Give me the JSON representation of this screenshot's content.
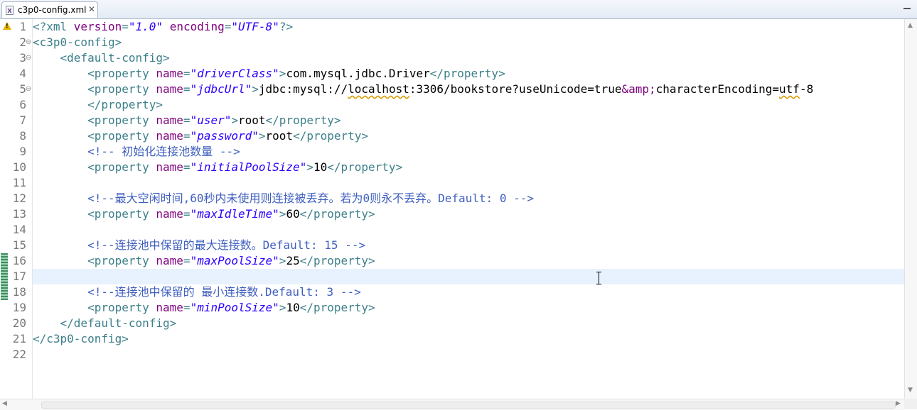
{
  "tab": {
    "title": "c3p0-config.xml",
    "close_glyph": "✕",
    "icon": "xml-file-icon",
    "icon_letter": "X"
  },
  "gutter": {
    "warning_icon": "warning-icon",
    "line_numbers": [
      "1",
      "2",
      "3",
      "4",
      "5",
      "6",
      "7",
      "8",
      "9",
      "10",
      "11",
      "12",
      "13",
      "14",
      "15",
      "16",
      "17",
      "18",
      "19",
      "20",
      "21",
      "22"
    ]
  },
  "editor": {
    "current_line": 17,
    "lines": [
      [
        [
          "pi",
          "<?xml "
        ],
        [
          "a",
          "version"
        ],
        [
          "pi",
          "="
        ],
        [
          "v",
          "\"1.0\""
        ],
        [
          "pi",
          " "
        ],
        [
          "a",
          "encoding"
        ],
        [
          "pi",
          "="
        ],
        [
          "v",
          "\"UTF-8\""
        ],
        [
          "pi",
          "?>"
        ]
      ],
      [
        [
          "t",
          "<c3p0-config>"
        ]
      ],
      [
        [
          "x",
          "    "
        ],
        [
          "t",
          "<default-config>"
        ]
      ],
      [
        [
          "x",
          "        "
        ],
        [
          "t",
          "<property "
        ],
        [
          "a",
          "name"
        ],
        [
          "t",
          "="
        ],
        [
          "v",
          "\"driverClass\""
        ],
        [
          "t",
          ">"
        ],
        [
          "x",
          "com.mysql.jdbc.Driver"
        ],
        [
          "t",
          "</property>"
        ]
      ],
      [
        [
          "x",
          "        "
        ],
        [
          "t",
          "<property "
        ],
        [
          "a",
          "name"
        ],
        [
          "t",
          "="
        ],
        [
          "v",
          "\"jdbcUrl\""
        ],
        [
          "t",
          ">"
        ],
        [
          "x",
          "jdbc:mysql://"
        ],
        [
          "sq",
          "localhost"
        ],
        [
          "x",
          ":3306/bookstore?useUnicode=true"
        ],
        [
          "a",
          "&amp;"
        ],
        [
          "x",
          "characterEncoding="
        ],
        [
          "sq",
          "utf"
        ],
        [
          "x",
          "-8"
        ]
      ],
      [
        [
          "x",
          "        "
        ],
        [
          "t",
          "</property>"
        ]
      ],
      [
        [
          "x",
          "        "
        ],
        [
          "t",
          "<property "
        ],
        [
          "a",
          "name"
        ],
        [
          "t",
          "="
        ],
        [
          "v",
          "\"user\""
        ],
        [
          "t",
          ">"
        ],
        [
          "x",
          "root"
        ],
        [
          "t",
          "</property>"
        ]
      ],
      [
        [
          "x",
          "        "
        ],
        [
          "t",
          "<property "
        ],
        [
          "a",
          "name"
        ],
        [
          "t",
          "="
        ],
        [
          "v",
          "\"password\""
        ],
        [
          "t",
          ">"
        ],
        [
          "x",
          "root"
        ],
        [
          "t",
          "</property>"
        ]
      ],
      [
        [
          "x",
          "        "
        ],
        [
          "c",
          "<!-- 初始化连接池数量 -->"
        ]
      ],
      [
        [
          "x",
          "        "
        ],
        [
          "t",
          "<property "
        ],
        [
          "a",
          "name"
        ],
        [
          "t",
          "="
        ],
        [
          "v",
          "\"initialPoolSize\""
        ],
        [
          "t",
          ">"
        ],
        [
          "x",
          "10"
        ],
        [
          "t",
          "</property>"
        ]
      ],
      [],
      [
        [
          "x",
          "        "
        ],
        [
          "c",
          "<!--最大空闲时间,60秒内未使用则连接被丢弃。若为0则永不丢弃。Default: 0 -->"
        ]
      ],
      [
        [
          "x",
          "        "
        ],
        [
          "t",
          "<property "
        ],
        [
          "a",
          "name"
        ],
        [
          "t",
          "="
        ],
        [
          "v",
          "\"maxIdleTime\""
        ],
        [
          "t",
          ">"
        ],
        [
          "x",
          "60"
        ],
        [
          "t",
          "</property>"
        ]
      ],
      [],
      [
        [
          "x",
          "        "
        ],
        [
          "c",
          "<!--连接池中保留的最大连接数。Default: 15 -->"
        ]
      ],
      [
        [
          "x",
          "        "
        ],
        [
          "t",
          "<property "
        ],
        [
          "a",
          "name"
        ],
        [
          "t",
          "="
        ],
        [
          "v",
          "\"maxPoolSize\""
        ],
        [
          "t",
          ">"
        ],
        [
          "x",
          "25"
        ],
        [
          "t",
          "</property>"
        ]
      ],
      [],
      [
        [
          "x",
          "        "
        ],
        [
          "c",
          "<!--连接池中保留的 最小连接数.Default: 3 -->"
        ]
      ],
      [
        [
          "x",
          "        "
        ],
        [
          "t",
          "<property "
        ],
        [
          "a",
          "name"
        ],
        [
          "t",
          "="
        ],
        [
          "v",
          "\"minPoolSize\""
        ],
        [
          "t",
          ">"
        ],
        [
          "x",
          "10"
        ],
        [
          "t",
          "</property>"
        ]
      ],
      [
        [
          "x",
          "    "
        ],
        [
          "t",
          "</default-config>"
        ]
      ],
      [
        [
          "t",
          "</c3p0-config>"
        ]
      ],
      []
    ],
    "folds": [
      2,
      3,
      5
    ],
    "fold_glyph": "⊖"
  },
  "scrollbars": {
    "up": "▲",
    "down": "▼",
    "left": "◀",
    "right": "▶"
  },
  "colors": {
    "tag": "#3c7f8a",
    "attribute": "#7f007f",
    "value": "#2a00ff",
    "comment": "#3f5fbf",
    "current_line": "#e8f2fe"
  }
}
